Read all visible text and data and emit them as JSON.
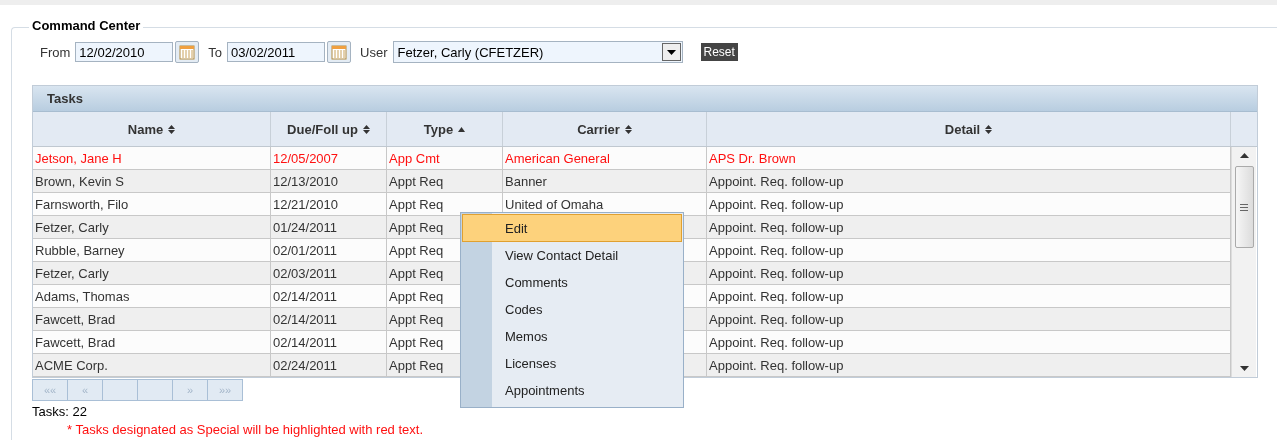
{
  "panel": {
    "title": "Command Center"
  },
  "filters": {
    "from_label": "From",
    "from_value": "12/02/2010",
    "to_label": "To",
    "to_value": "03/02/2011",
    "user_label": "User",
    "user_value": "Fetzer, Carly (CFETZER)",
    "reset": "Reset"
  },
  "tasks": {
    "title": "Tasks",
    "columns": [
      {
        "label": "Name",
        "sorted": false
      },
      {
        "label": "Due/Foll up",
        "sorted": false
      },
      {
        "label": "Type",
        "sorted": true
      },
      {
        "label": "Carrier",
        "sorted": false
      },
      {
        "label": "Detail",
        "sorted": false
      }
    ],
    "rows": [
      {
        "special": true,
        "cells": [
          "Jetson, Jane H",
          "12/05/2007",
          "App Cmt",
          "American General",
          "APS Dr. Brown"
        ]
      },
      {
        "special": false,
        "cells": [
          "Brown, Kevin S",
          "12/13/2010",
          "Appt Req",
          "Banner",
          "Appoint. Req. follow-up"
        ]
      },
      {
        "special": false,
        "cells": [
          "Farnsworth, Filo",
          "12/21/2010",
          "Appt Req",
          "United of Omaha",
          "Appoint. Req. follow-up"
        ]
      },
      {
        "special": false,
        "cells": [
          "Fetzer, Carly",
          "01/24/2011",
          "Appt Req",
          null,
          "Appoint. Req. follow-up"
        ]
      },
      {
        "special": false,
        "cells": [
          "Rubble, Barney",
          "02/01/2011",
          "Appt Req",
          null,
          "Appoint. Req. follow-up"
        ]
      },
      {
        "special": false,
        "cells": [
          "Fetzer, Carly",
          "02/03/2011",
          "Appt Req",
          null,
          "Appoint. Req. follow-up"
        ]
      },
      {
        "special": false,
        "cells": [
          "Adams, Thomas",
          "02/14/2011",
          "Appt Req",
          null,
          "Appoint. Req. follow-up"
        ]
      },
      {
        "special": false,
        "cells": [
          "Fawcett, Brad",
          "02/14/2011",
          "Appt Req",
          null,
          "Appoint. Req. follow-up"
        ]
      },
      {
        "special": false,
        "cells": [
          "Fawcett, Brad",
          "02/14/2011",
          "Appt Req",
          null,
          "Appoint. Req. follow-up"
        ]
      },
      {
        "special": false,
        "cells": [
          "ACME Corp.",
          "02/24/2011",
          "Appt Req",
          null,
          "Appoint. Req. follow-up"
        ]
      }
    ],
    "pager": [
      {
        "label": "««",
        "disabled": true
      },
      {
        "label": "«",
        "disabled": true
      },
      {
        "disabled": true
      },
      {
        "disabled": true
      },
      {
        "label": "»",
        "disabled": true
      },
      {
        "label": "»»",
        "disabled": true
      }
    ],
    "count": "Tasks: 22",
    "note": "* Tasks designated as Special will be highlighted with red text."
  },
  "context_menu": [
    {
      "label": "Edit",
      "selected": true
    },
    {
      "label": "View Contact Detail",
      "selected": false
    },
    {
      "label": "Comments",
      "selected": false
    },
    {
      "label": "Codes",
      "selected": false
    },
    {
      "label": "Memos",
      "selected": false
    },
    {
      "label": "Licenses",
      "selected": false
    },
    {
      "label": "Appointments",
      "selected": false
    }
  ]
}
